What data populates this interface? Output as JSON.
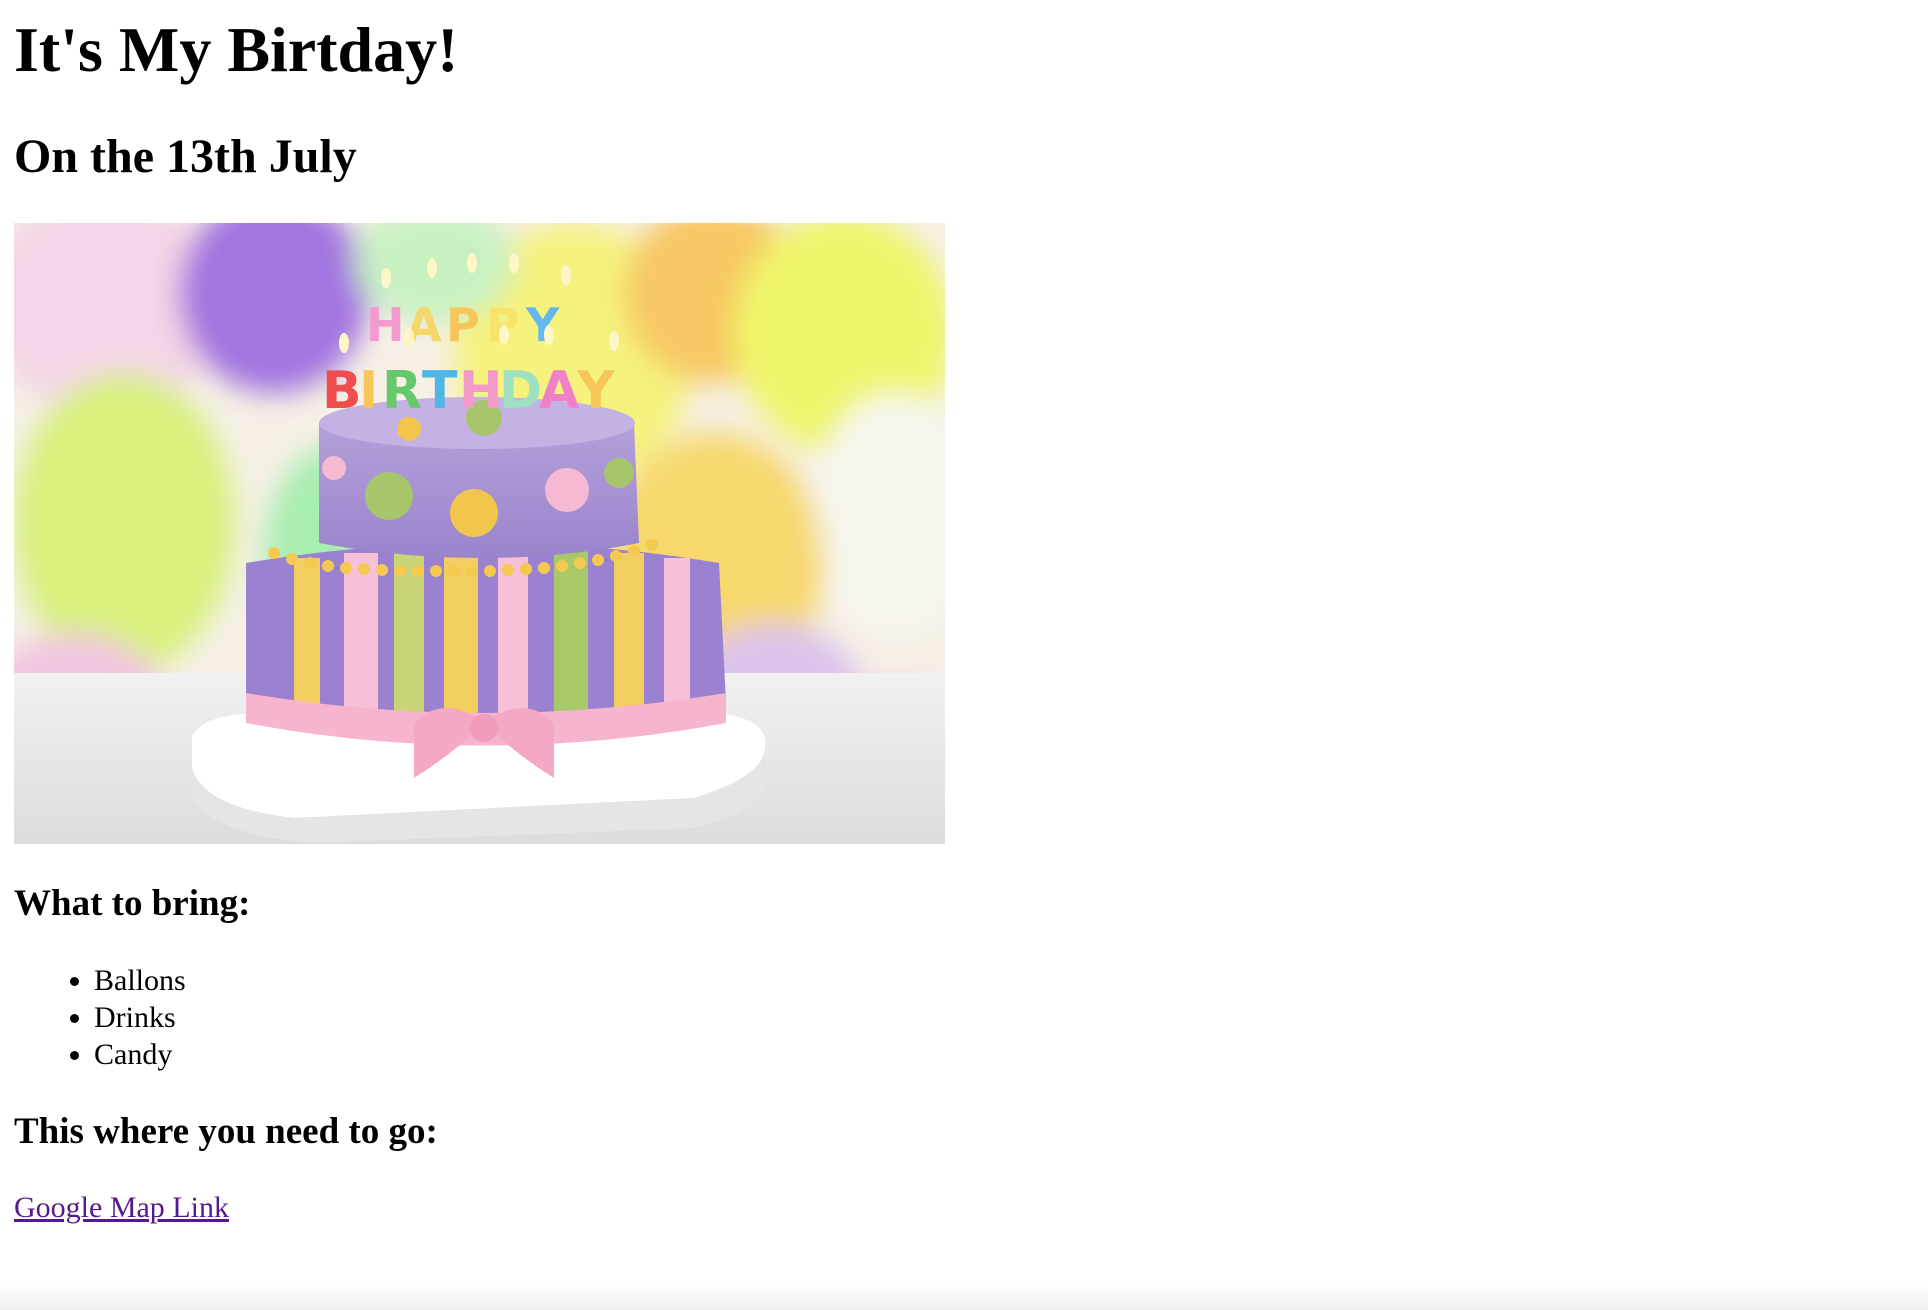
{
  "page": {
    "title": "It's My Birtday!",
    "subtitle": "On the 13th July",
    "image": {
      "alt": "Birthday cake",
      "candle_text": [
        "HAPPY",
        "BIRTHDAY"
      ],
      "icon": "birthday-cake-photo"
    },
    "bring": {
      "heading": "What to bring:",
      "items": [
        "Ballons",
        "Drinks",
        "Candy"
      ]
    },
    "directions": {
      "heading": "This where you need to go:",
      "link_text": "Google Map Link"
    }
  },
  "colors": {
    "visited_link": "#551a8b",
    "text": "#000000",
    "background": "#ffffff"
  }
}
